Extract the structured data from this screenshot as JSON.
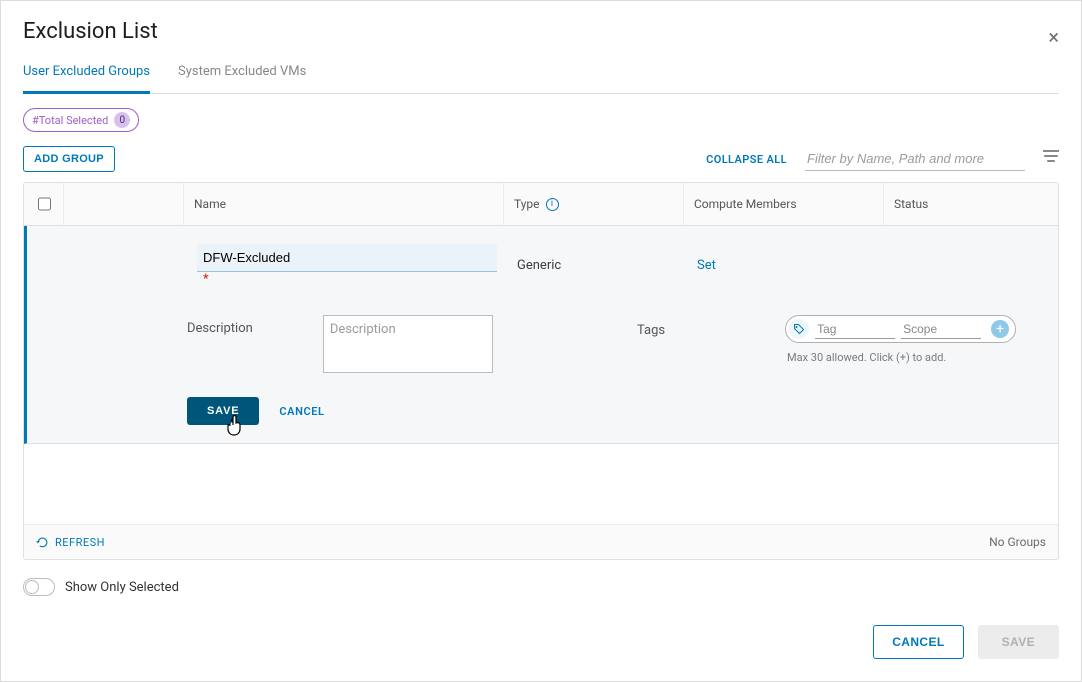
{
  "dialog": {
    "title": "Exclusion List"
  },
  "tabs": {
    "user": "User Excluded Groups",
    "system": "System Excluded VMs"
  },
  "selection_pill": {
    "label": "#Total Selected",
    "count": "0"
  },
  "toolbar": {
    "add_group": "ADD GROUP",
    "collapse_all": "COLLAPSE ALL",
    "filter_placeholder": "Filter by Name, Path and more"
  },
  "columns": {
    "name": "Name",
    "type": "Type",
    "compute_members": "Compute Members",
    "status": "Status"
  },
  "row": {
    "name_value": "DFW-Excluded",
    "type_value": "Generic",
    "compute_link": "Set",
    "description_label": "Description",
    "description_placeholder": "Description",
    "tags_label": "Tags",
    "tag_placeholder": "Tag",
    "scope_placeholder": "Scope",
    "tag_hint": "Max 30 allowed. Click (+) to add.",
    "save_label": "SAVE",
    "cancel_label": "CANCEL"
  },
  "table_footer": {
    "refresh": "REFRESH",
    "no_groups": "No Groups"
  },
  "toggle": {
    "label": "Show Only Selected"
  },
  "footer": {
    "cancel": "CANCEL",
    "save": "SAVE"
  }
}
